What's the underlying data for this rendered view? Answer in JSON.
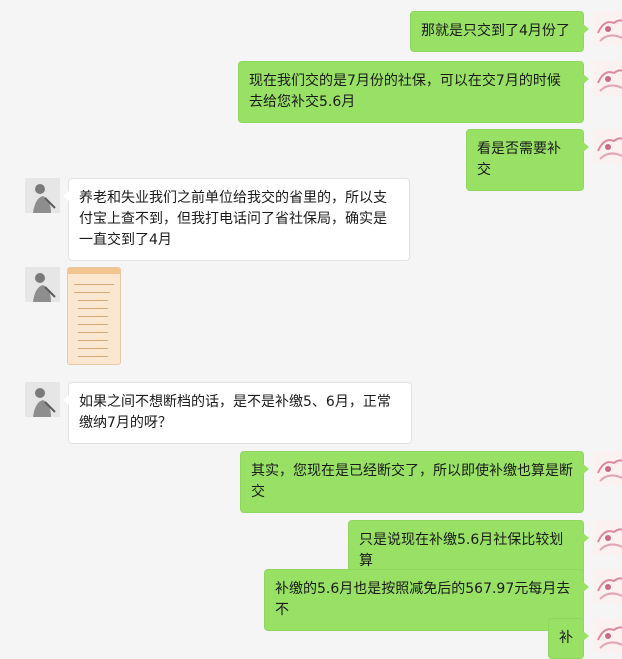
{
  "messages": [
    {
      "side": "right",
      "text": "那就是只交到了4月份了"
    },
    {
      "side": "right",
      "text": "现在我们交的是7月份的社保，可以在交7月的时候去给您补交5.6月"
    },
    {
      "side": "right",
      "text": "看是否需要补交"
    },
    {
      "side": "left",
      "text": "养老和失业我们之前单位给我交的省里的，所以支付宝上查不到，但我打电话问了省社保局，确实是一直交到了4月"
    },
    {
      "side": "left",
      "type": "image"
    },
    {
      "side": "left",
      "text": "如果之间不想断档的话，是不是补缴5、6月，正常缴纳7月的呀？"
    },
    {
      "side": "right",
      "text": "其实，您现在是已经断交了，所以即使补缴也算是断交"
    },
    {
      "side": "right",
      "text": "只是说现在补缴5.6月社保比较划算"
    },
    {
      "side": "right",
      "text": "补缴的5.6月也是按照减免后的567.97元每月去不"
    },
    {
      "side": "right",
      "text": "补"
    }
  ],
  "colors": {
    "background": "#f5f5f5",
    "bubble_right": "#98e165",
    "bubble_left": "#ffffff"
  }
}
